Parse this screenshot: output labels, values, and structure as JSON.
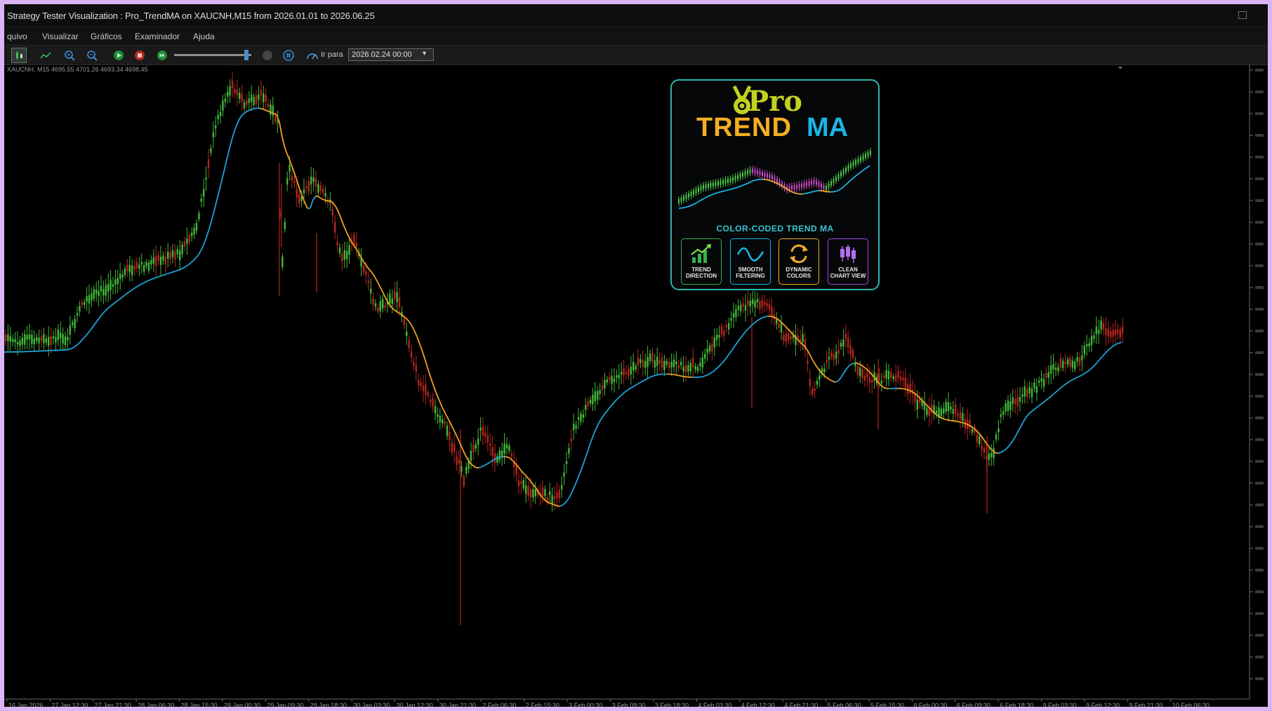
{
  "window": {
    "title": "Strategy Tester Visualization : Pro_TrendMA on XAUCNH,M15 from 2026.01.01 to 2026.06.25"
  },
  "menu": [
    "quivo",
    "Visualizar",
    "Gráficos",
    "Examinador",
    "Ajuda"
  ],
  "toolbar": {
    "goto_label": "Ir para",
    "goto_value": "2026.02.24 00:00"
  },
  "chart": {
    "header_text": "XAUCNH, M15  4695.55 4701.26 4693.34 4698.45",
    "bull_color": "#43b83a",
    "bear_color": "#b3261e",
    "ma_up_color": "#1fa2d6",
    "ma_down_color": "#f0a221",
    "x_tick_labels": [
      "16 Jan 2026",
      "27 Jan 12:30",
      "27 Jan 21:30",
      "28 Jan 06:30",
      "28 Jan 15:30",
      "29 Jan 00:30",
      "29 Jan 09:30",
      "29 Jan 18:30",
      "30 Jan 03:30",
      "30 Jan 12:30",
      "30 Jan 21:30",
      "2 Feb 06:30",
      "2 Feb 15:30",
      "3 Feb 00:30",
      "3 Feb 09:30",
      "3 Feb 18:30",
      "4 Feb 03:30",
      "4 Feb 12:30",
      "4 Feb 21:30",
      "5 Feb 06:30",
      "5 Feb 15:30",
      "6 Feb 00:30",
      "6 Feb 09:30",
      "6 Feb 18:30",
      "9 Feb 03:30",
      "9 Feb 12:30",
      "9 Feb 21:30",
      "10 Feb 06:30"
    ]
  },
  "promo": {
    "pro": "Pro",
    "trend": "TREND",
    "ma": "MA",
    "subtitle": "COLOR-CODED TREND MA",
    "features": [
      {
        "line1": "TREND",
        "line2": "DIRECTION",
        "icon": "trend-arrow-icon",
        "color": "#37b24d"
      },
      {
        "line1": "SMOOTH",
        "line2": "FILTERING",
        "icon": "wave-icon",
        "color": "#1ab4e6"
      },
      {
        "line1": "DYNAMIC",
        "line2": "COLORS",
        "icon": "refresh-icon",
        "color": "#f4ae22"
      },
      {
        "line1": "CLEAN",
        "line2": "CHART VIEW",
        "icon": "candles-icon",
        "color": "#a24be8"
      }
    ]
  }
}
